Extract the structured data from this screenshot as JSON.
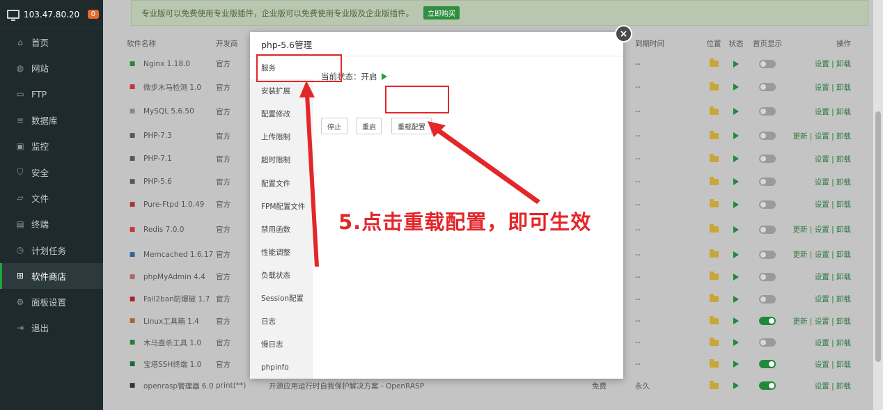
{
  "sidebar": {
    "host": "103.47.80.20",
    "badge": "0",
    "items": [
      {
        "label": "首页",
        "icon": "home-icon"
      },
      {
        "label": "网站",
        "icon": "globe-icon"
      },
      {
        "label": "FTP",
        "icon": "ftp-icon"
      },
      {
        "label": "数据库",
        "icon": "database-icon"
      },
      {
        "label": "监控",
        "icon": "monitor-icon"
      },
      {
        "label": "安全",
        "icon": "shield-icon"
      },
      {
        "label": "文件",
        "icon": "folder-icon"
      },
      {
        "label": "终端",
        "icon": "terminal-icon"
      },
      {
        "label": "计划任务",
        "icon": "clock-icon"
      },
      {
        "label": "软件商店",
        "icon": "grid-icon"
      },
      {
        "label": "面板设置",
        "icon": "gear-icon"
      },
      {
        "label": "退出",
        "icon": "logout-icon"
      }
    ]
  },
  "notice": {
    "text": "专业版可以免费使用专业版插件，企业版可以免费使用专业版及企业版插件。",
    "buy_label": "立即购买"
  },
  "table": {
    "headers": {
      "name": "软件名称",
      "dev": "开发商",
      "expire": "到期时间",
      "pos": "位置",
      "status": "状态",
      "home": "首页显示",
      "ops": "操作"
    },
    "rows": [
      {
        "name": "Nginx 1.18.0",
        "dev": "官方",
        "expire": "--",
        "home_on": false,
        "ops": "设置 | 卸载"
      },
      {
        "name": "微步木马检测 1.0",
        "dev": "官方",
        "expire": "--",
        "home_on": false,
        "ops": "设置 | 卸载"
      },
      {
        "name": "MySQL 5.6.50",
        "dev": "官方",
        "expire": "--",
        "home_on": false,
        "ops": "设置 | 卸载"
      },
      {
        "name": "PHP-7.3",
        "dev": "官方",
        "expire": "--",
        "home_on": false,
        "ops": "更新 | 设置 | 卸载"
      },
      {
        "name": "PHP-7.1",
        "dev": "官方",
        "expire": "--",
        "home_on": false,
        "ops": "设置 | 卸载"
      },
      {
        "name": "PHP-5.6",
        "dev": "官方",
        "expire": "--",
        "home_on": false,
        "ops": "设置 | 卸载"
      },
      {
        "name": "Pure-Ftpd 1.0.49",
        "dev": "官方",
        "expire": "--",
        "home_on": false,
        "ops": "设置 | 卸载"
      },
      {
        "name": "Redis 7.0.0",
        "dev": "官方",
        "expire": "--",
        "home_on": false,
        "ops": "更新 | 设置 | 卸载"
      },
      {
        "name": "Memcached 1.6.17",
        "dev": "官方",
        "expire": "--",
        "home_on": false,
        "ops": "更新 | 设置 | 卸载"
      },
      {
        "name": "phpMyAdmin 4.4",
        "dev": "官方",
        "expire": "--",
        "home_on": false,
        "ops": "设置 | 卸载"
      },
      {
        "name": "Fail2ban防爆破 1.7",
        "dev": "官方",
        "expire": "--",
        "home_on": false,
        "ops": "设置 | 卸载"
      },
      {
        "name": "Linux工具箱 1.4",
        "dev": "官方",
        "expire": "--",
        "home_on": true,
        "ops": "更新 | 设置 | 卸载"
      },
      {
        "name": "木马查杀工具 1.0",
        "dev": "官方",
        "expire": "--",
        "home_on": false,
        "ops": "设置 | 卸载"
      },
      {
        "name": "宝塔SSH终端 1.0",
        "dev": "官方",
        "expire": "--",
        "home_on": true,
        "ops": "设置 | 卸载"
      },
      {
        "name": "openrasp管理器 6.0",
        "dev": "print(**)",
        "desc": "开源应用运行时自我保护解决方案 - OpenRASP",
        "price": "免费",
        "expire": "永久",
        "home_on": true,
        "ops": "设置 | 卸载"
      }
    ]
  },
  "modal": {
    "title": "php-5.6管理",
    "close": "×",
    "menu": [
      "服务",
      "安装扩展",
      "配置修改",
      "上传限制",
      "超时限制",
      "配置文件",
      "FPM配置文件",
      "禁用函数",
      "性能调整",
      "负载状态",
      "Session配置",
      "日志",
      "慢日志",
      "phpinfo"
    ],
    "status_label": "当前状态：",
    "status_value": "开启",
    "buttons": {
      "stop": "停止",
      "restart": "重启",
      "reload": "重载配置"
    }
  },
  "annotation": {
    "callout": "5.点击重载配置，即可生效",
    "color": "#e3262a"
  }
}
